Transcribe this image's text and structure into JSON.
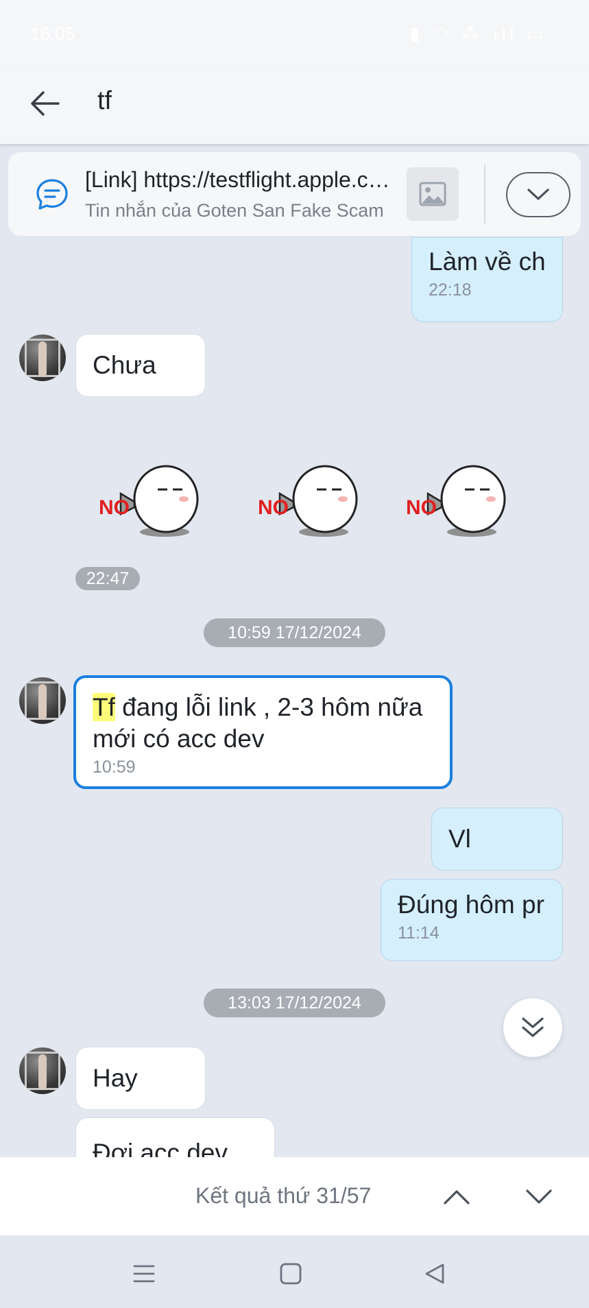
{
  "status_bar": {
    "time": "16:05",
    "icons": "▮ ◠ ⁂ ıll ▭"
  },
  "header": {
    "query": "tf"
  },
  "pinned": {
    "title": "[Link] https://testflight.apple.com/join/...",
    "subtitle": "Tin nhắn của Goten San Fake Scam"
  },
  "messages": {
    "m1": {
      "text": "Làm về ch",
      "time": "22:18"
    },
    "m2": {
      "text": "Chưa"
    },
    "sticker_label": "NO",
    "sticker_time": "22:47",
    "date1": "10:59 17/12/2024",
    "m3": {
      "highlight": "Tf",
      "text": " đang lỗi link , 2-3 hôm nữa mới có acc dev",
      "time": "10:59"
    },
    "m4": {
      "text": "Vl"
    },
    "m5": {
      "text": "Đúng hôm pr",
      "time": "11:14"
    },
    "date2": "13:03 17/12/2024",
    "m6": {
      "text": "Hay"
    },
    "m7": {
      "text": "Đợi acc dev về"
    }
  },
  "search_results": {
    "label": "Kết quả thứ 31/57"
  },
  "colors": {
    "accent": "#1a7fe0",
    "outgoing_bubble": "#d5effd",
    "highlight": "#fffc7a",
    "background": "#e2e7f0"
  }
}
